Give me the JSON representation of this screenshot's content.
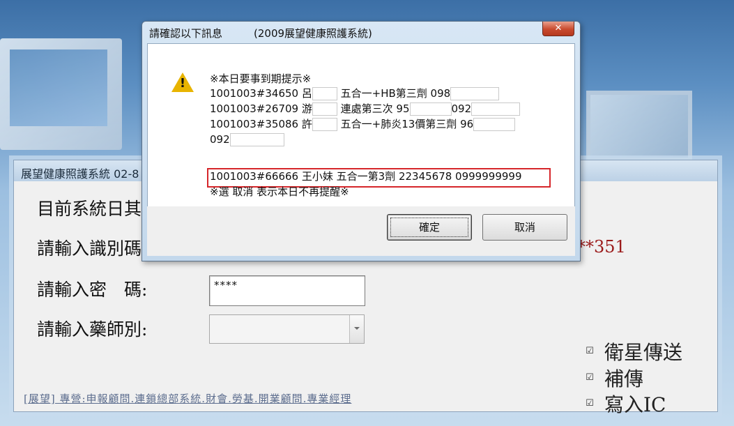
{
  "main_window": {
    "title": "展望健康照護系統 02-8",
    "labels": {
      "date": "目前系統日其",
      "id": "請輸入識別碼",
      "password": "請輸入密　碼:",
      "pharmacist": "請輸入藥師別:"
    },
    "password_value": "****",
    "id_hint": "**351",
    "checkboxes": [
      {
        "label": "衛星傳送",
        "checked": true
      },
      {
        "label": "補傳",
        "checked": true
      },
      {
        "label": "寫入IC",
        "checked": true
      }
    ],
    "footer_link": "[展望] 專營:申報顧問.連鎖總部系統.財會.勞基.開業顧問.專業經理"
  },
  "dialog": {
    "title": "請確認以下訊息　　　(2009展望健康照護系統)",
    "close_label": "✕",
    "icon": "warning-icon",
    "lines": {
      "header": "※本日要事到期提示※",
      "l1_a": "1001003#34650 呂",
      "l1_b": "五合一+HB第三劑 098",
      "l2_a": "1001003#26709 游",
      "l2_b": "連處第三次 95",
      "l2_c": "092",
      "l3_a": "1001003#35086 許",
      "l3_b": "五合一+肺炎13價第三劑 96",
      "l4_a": "092",
      "highlight": "1001003#66666 王小妹 五合一第3劑 22345678 0999999999",
      "footer": "※選 取消 表示本日不再提醒※"
    },
    "ok_label": "確定",
    "cancel_label": "取消"
  },
  "colors": {
    "highlight_border": "#d6262a",
    "hint_red": "#9b1a1a",
    "link": "#5c6d8e"
  }
}
